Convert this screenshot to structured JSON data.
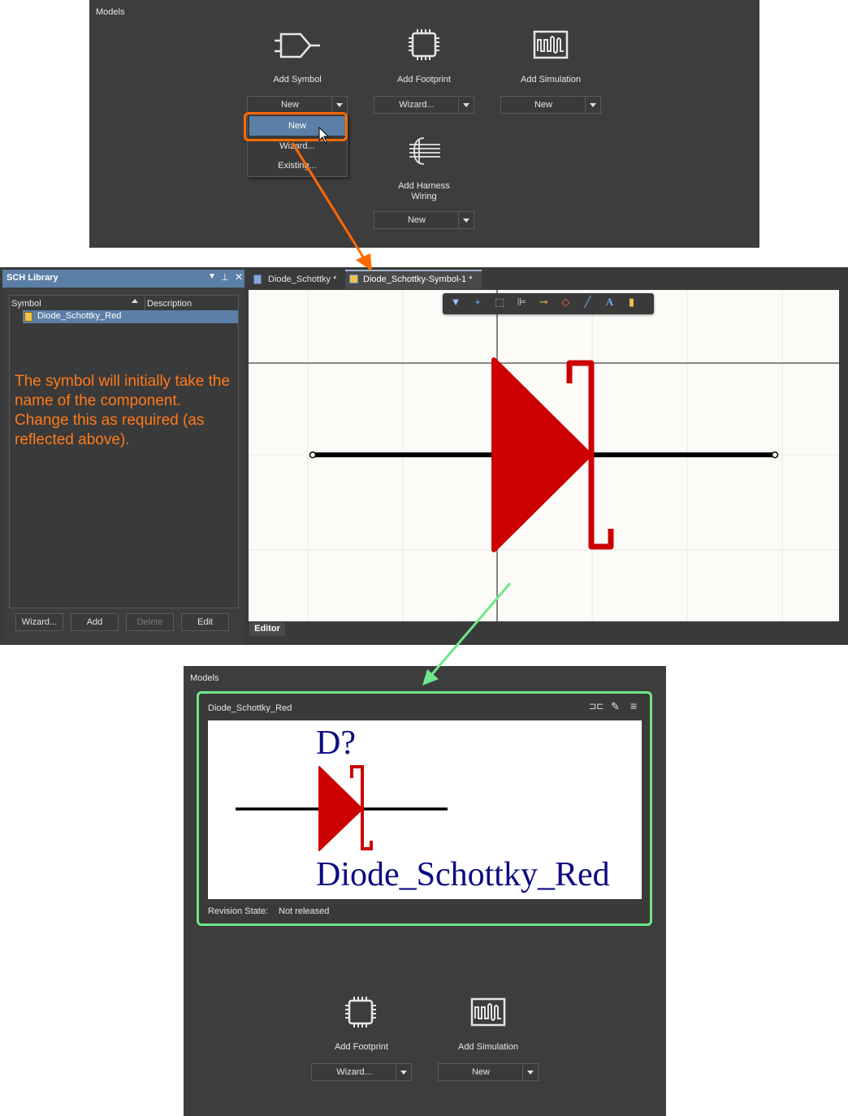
{
  "top_models": {
    "title": "Models",
    "add_symbol": {
      "label": "Add Symbol",
      "dropdown_value": "New"
    },
    "add_footprint": {
      "label": "Add Footprint",
      "dropdown_value": "Wizard..."
    },
    "add_simulation": {
      "label": "Add Simulation",
      "dropdown_value": "New"
    },
    "add_harness": {
      "label_line1": "Add Harness",
      "label_line2": "Wiring",
      "dropdown_value": "New"
    },
    "menu": {
      "items": [
        "New",
        "Wizard...",
        "Existing..."
      ]
    }
  },
  "sch_library": {
    "title": "SCH Library",
    "columns": [
      "Symbol",
      "Description"
    ],
    "rows": [
      {
        "symbol": "Diode_Schottky_Red",
        "description": ""
      }
    ],
    "annotation": "The symbol will initially take the name of the component. Change this as required (as reflected above).",
    "buttons": {
      "wizard": "Wizard...",
      "add": "Add",
      "delete": "Delete",
      "edit": "Edit"
    }
  },
  "editor": {
    "tabs": [
      "Diode_Schottky *",
      "Diode_Schottky-Symbol-1 *"
    ],
    "bottom_tab": "Editor"
  },
  "bottom_models": {
    "title": "Models",
    "card": {
      "name": "Diode_Schottky_Red",
      "designator": "D?",
      "comment": "Diode_Schottky_Red",
      "revision_label": "Revision State:",
      "revision_value": "Not released"
    },
    "add_footprint": {
      "label": "Add Footprint",
      "dropdown_value": "Wizard..."
    },
    "add_simulation": {
      "label": "Add Simulation",
      "dropdown_value": "New"
    }
  },
  "colors": {
    "panel_bg": "#3d3d3d",
    "highlight_orange": "#ff6a00",
    "highlight_green": "#6ee88a",
    "diode_red": "#cc0000",
    "selection_blue": "#5b7fa6",
    "canvas_bg": "#fdfbf8",
    "annotation_text": "#ff7a1a",
    "preview_text": "#0a0a80"
  }
}
